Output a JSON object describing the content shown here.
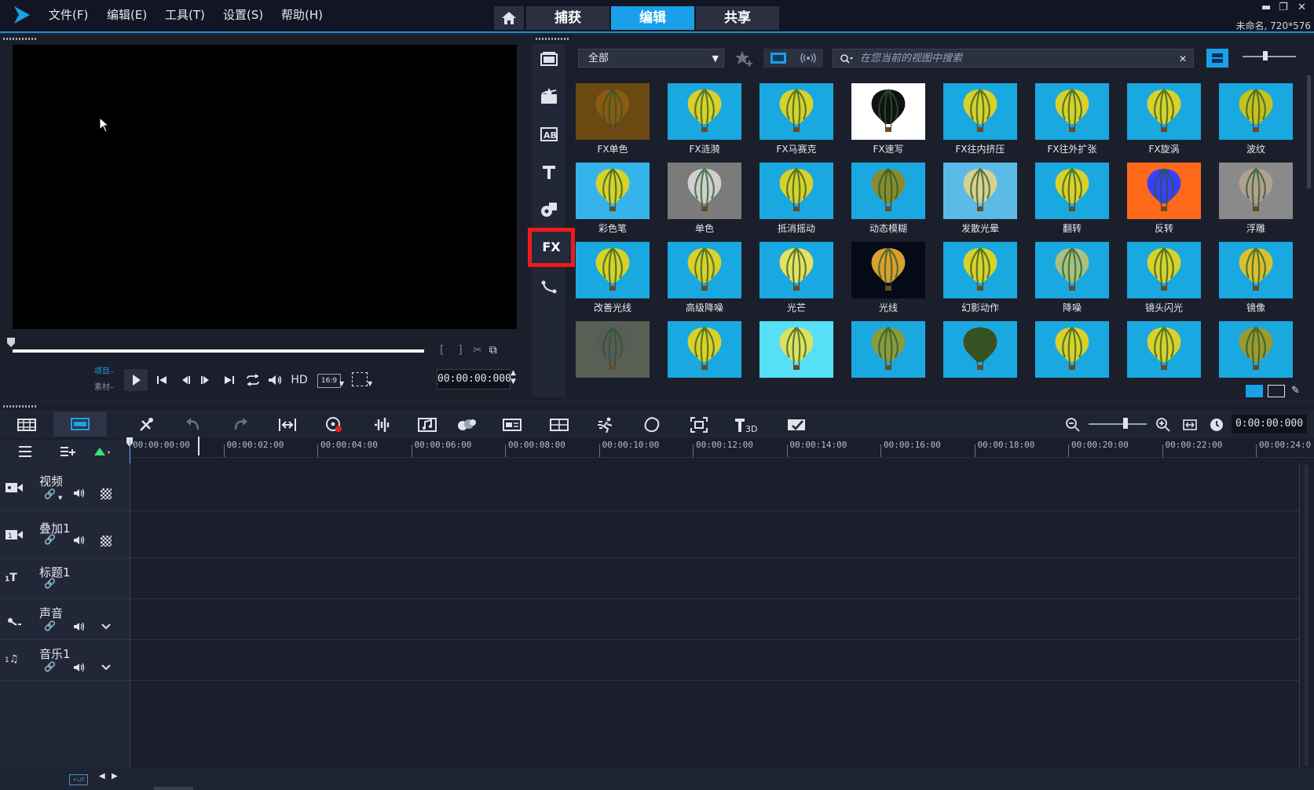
{
  "menu": [
    "文件(F)",
    "编辑(E)",
    "工具(T)",
    "设置(S)",
    "帮助(H)"
  ],
  "mode_tabs": [
    "捕获",
    "编辑",
    "共享"
  ],
  "project_info": "未命名, 720*576",
  "preview": {
    "project_label": "项目",
    "clip_label": "素材",
    "hd_label": "HD",
    "aspect_label": "16:9",
    "timecode": "00:00:00:000"
  },
  "library": {
    "category": "全部",
    "search_placeholder": "在您当前的视图中搜索",
    "active_sidebar": "FX",
    "filters": [
      [
        "FX单色",
        "FX涟漪",
        "FX马赛克",
        "FX速写",
        "FX往内挤压",
        "FX往外扩张",
        "FX旋涡",
        "波纹"
      ],
      [
        "彩色笔",
        "单色",
        "抵消摇动",
        "动态模糊",
        "发散光晕",
        "翻转",
        "反转",
        "浮雕"
      ],
      [
        "改善光线",
        "高级降噪",
        "光芒",
        "光线",
        "幻影动作",
        "降噪",
        "镜头闪光",
        "镜像"
      ],
      [
        "",
        "",
        "",
        "",
        "",
        "",
        "",
        ""
      ]
    ]
  },
  "timeline": {
    "timecode": "0:00:00:000",
    "ruler_ticks": [
      "00:00:00:00",
      "00:00:02:00",
      "00:00:04:00",
      "00:00:06:00",
      "00:00:08:00",
      "00:00:10:00",
      "00:00:12:00",
      "00:00:14:00",
      "00:00:16:00",
      "00:00:18:00",
      "00:00:20:00",
      "00:00:22:00",
      "00:00:24:0"
    ],
    "tracks": [
      "视频",
      "叠加1",
      "标题1",
      "声音",
      "音乐1"
    ]
  }
}
